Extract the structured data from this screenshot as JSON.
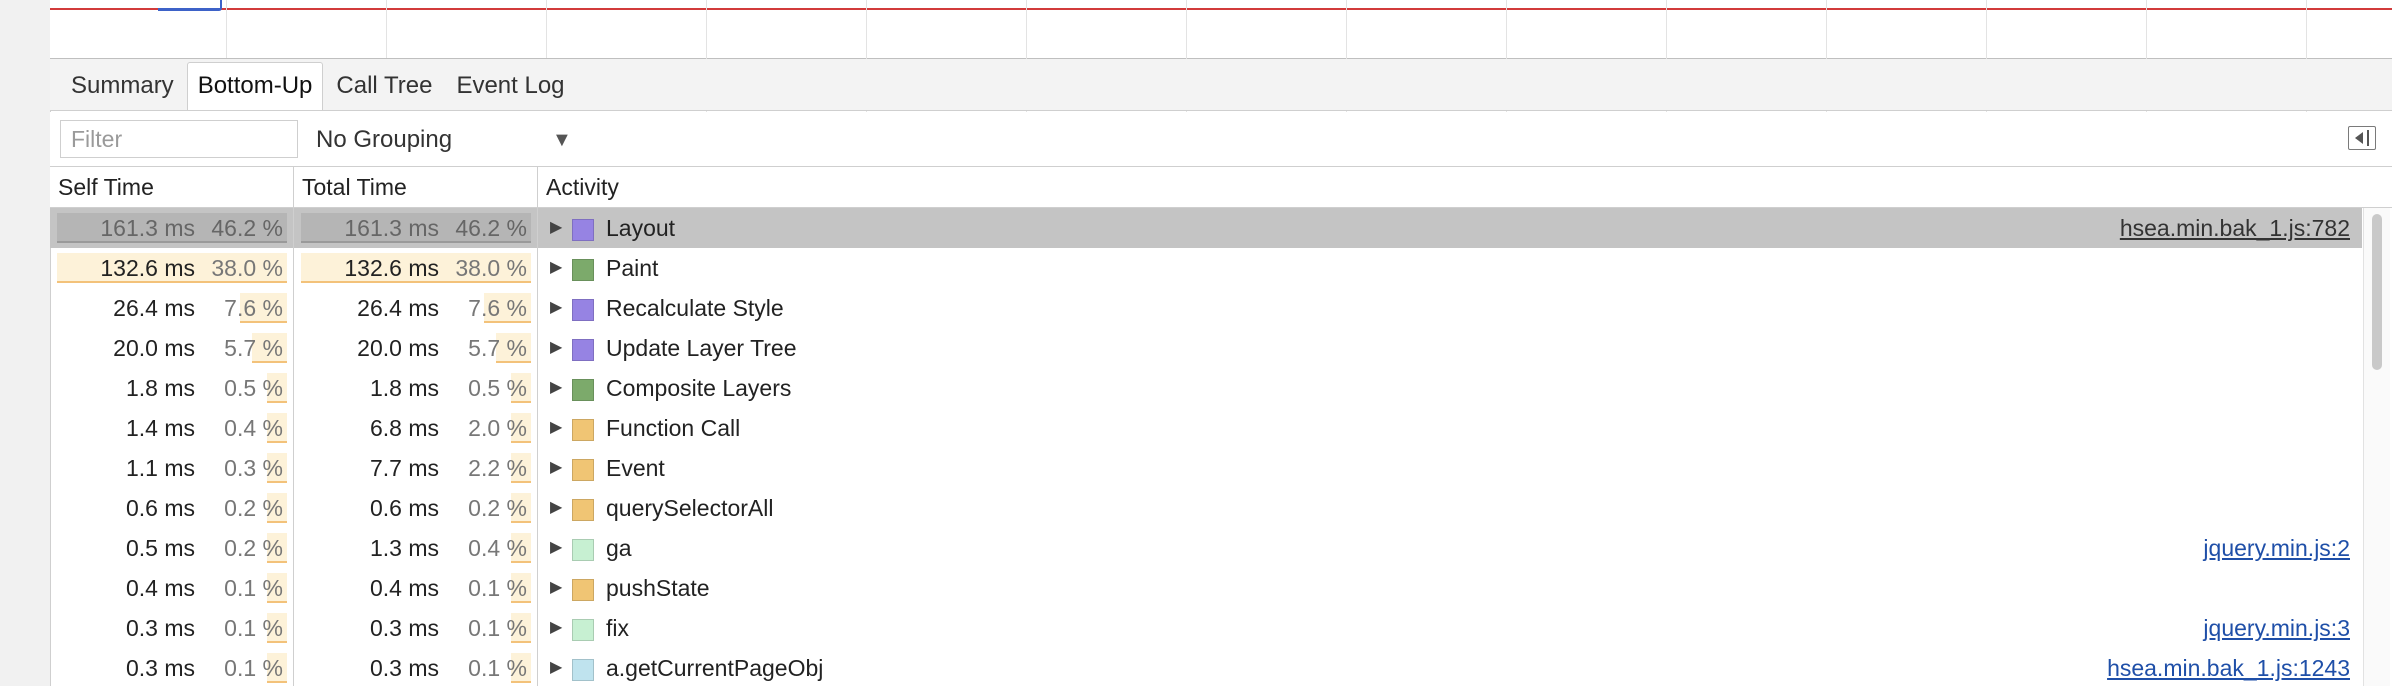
{
  "colors": {
    "layout": "#9683e3",
    "paint": "#7caa6b",
    "scripting": "#f0c574",
    "ga": "#c7f0d2",
    "current_page": "#bfe3ee",
    "link": "#1f4fa8",
    "selected_row": "#c4c4c4"
  },
  "tabs": [
    {
      "label": "Summary"
    },
    {
      "label": "Bottom-Up"
    },
    {
      "label": "Call Tree"
    },
    {
      "label": "Event Log"
    }
  ],
  "toolbar": {
    "filter_placeholder": "Filter",
    "grouping_value": "No Grouping",
    "grouping_caret_icon": "dropdown-triangle-icon",
    "sidebar_toggle_icon": "show-sidebar-icon"
  },
  "columns": {
    "self": "Self Time",
    "total": "Total Time",
    "activity": "Activity"
  },
  "rows": [
    {
      "self_ms": "161.3 ms",
      "self_pct": "46.2 %",
      "self_frac": 0.462,
      "total_ms": "161.3 ms",
      "total_pct": "46.2 %",
      "total_frac": 0.462,
      "name": "Layout",
      "color": "#9683e3",
      "link": "hsea.min.bak_1.js:782",
      "selected": true
    },
    {
      "self_ms": "132.6 ms",
      "self_pct": "38.0 %",
      "self_frac": 0.38,
      "total_ms": "132.6 ms",
      "total_pct": "38.0 %",
      "total_frac": 0.38,
      "name": "Paint",
      "color": "#7caa6b",
      "link": ""
    },
    {
      "self_ms": "26.4 ms",
      "self_pct": "7.6 %",
      "self_frac": 0.076,
      "total_ms": "26.4 ms",
      "total_pct": "7.6 %",
      "total_frac": 0.076,
      "name": "Recalculate Style",
      "color": "#9683e3",
      "link": ""
    },
    {
      "self_ms": "20.0 ms",
      "self_pct": "5.7 %",
      "self_frac": 0.057,
      "total_ms": "20.0 ms",
      "total_pct": "5.7 %",
      "total_frac": 0.057,
      "name": "Update Layer Tree",
      "color": "#9683e3",
      "link": ""
    },
    {
      "self_ms": "1.8 ms",
      "self_pct": "0.5 %",
      "self_frac": 0.005,
      "total_ms": "1.8 ms",
      "total_pct": "0.5 %",
      "total_frac": 0.005,
      "name": "Composite Layers",
      "color": "#7caa6b",
      "link": ""
    },
    {
      "self_ms": "1.4 ms",
      "self_pct": "0.4 %",
      "self_frac": 0.004,
      "total_ms": "6.8 ms",
      "total_pct": "2.0 %",
      "total_frac": 0.02,
      "name": "Function Call",
      "color": "#f0c574",
      "link": ""
    },
    {
      "self_ms": "1.1 ms",
      "self_pct": "0.3 %",
      "self_frac": 0.003,
      "total_ms": "7.7 ms",
      "total_pct": "2.2 %",
      "total_frac": 0.022,
      "name": "Event",
      "color": "#f0c574",
      "link": ""
    },
    {
      "self_ms": "0.6 ms",
      "self_pct": "0.2 %",
      "self_frac": 0.002,
      "total_ms": "0.6 ms",
      "total_pct": "0.2 %",
      "total_frac": 0.002,
      "name": "querySelectorAll",
      "color": "#f0c574",
      "link": ""
    },
    {
      "self_ms": "0.5 ms",
      "self_pct": "0.2 %",
      "self_frac": 0.002,
      "total_ms": "1.3 ms",
      "total_pct": "0.4 %",
      "total_frac": 0.004,
      "name": "ga",
      "color": "#c7f0d2",
      "link": "jquery.min.js:2"
    },
    {
      "self_ms": "0.4 ms",
      "self_pct": "0.1 %",
      "self_frac": 0.001,
      "total_ms": "0.4 ms",
      "total_pct": "0.1 %",
      "total_frac": 0.001,
      "name": "pushState",
      "color": "#f0c574",
      "link": ""
    },
    {
      "self_ms": "0.3 ms",
      "self_pct": "0.1 %",
      "self_frac": 0.001,
      "total_ms": "0.3 ms",
      "total_pct": "0.1 %",
      "total_frac": 0.001,
      "name": "fix",
      "color": "#c7f0d2",
      "link": "jquery.min.js:3"
    },
    {
      "self_ms": "0.3 ms",
      "self_pct": "0.1 %",
      "self_frac": 0.001,
      "total_ms": "0.3 ms",
      "total_pct": "0.1 %",
      "total_frac": 0.001,
      "name": "a.getCurrentPageObj",
      "color": "#bfe3ee",
      "link": "hsea.min.bak_1.js:1243"
    }
  ]
}
